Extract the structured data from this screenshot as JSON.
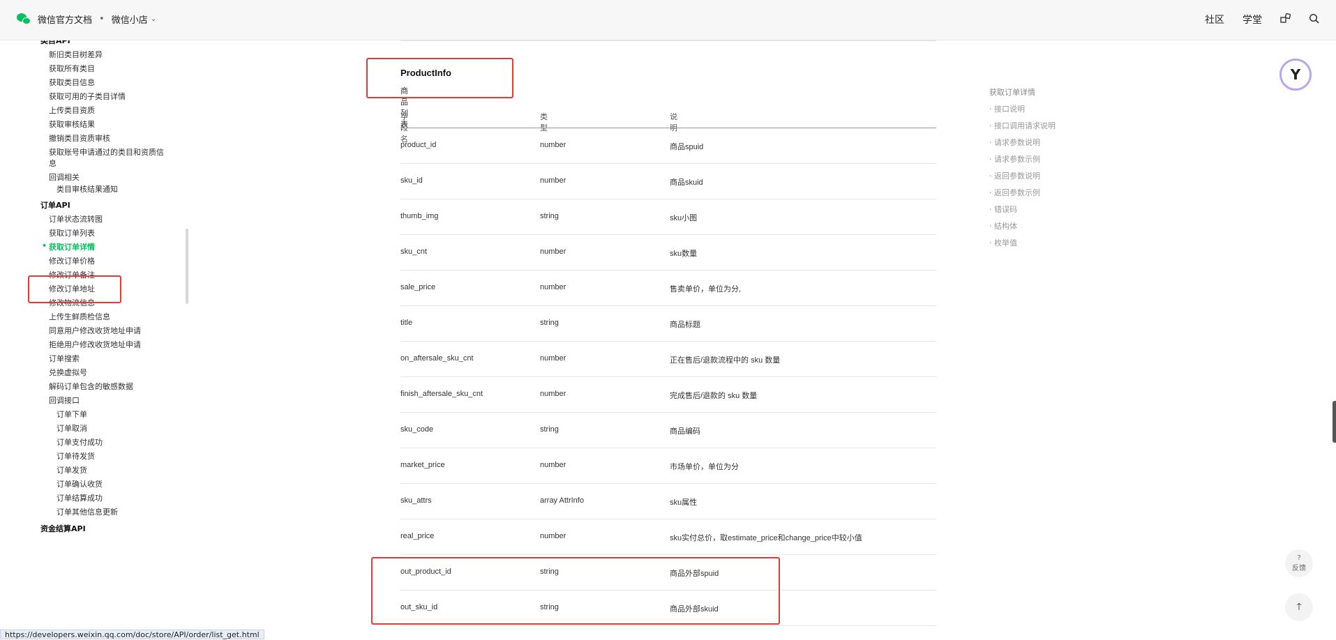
{
  "header": {
    "brand": "微信官方文档",
    "separator": "•",
    "section": "微信小店",
    "nav": [
      "社区",
      "学堂"
    ],
    "icons": [
      "grid-icon",
      "search-icon"
    ]
  },
  "sidebar": {
    "items": [
      {
        "text": "类目API",
        "type": "head",
        "indent": 0
      },
      {
        "text": "新旧类目树差异",
        "indent": 1
      },
      {
        "text": "获取所有类目",
        "indent": 1
      },
      {
        "text": "获取类目信息",
        "indent": 1
      },
      {
        "text": "获取可用的子类目详情",
        "indent": 1
      },
      {
        "text": "上传类目资质",
        "indent": 1
      },
      {
        "text": "获取审核结果",
        "indent": 1
      },
      {
        "text": "撤销类目资质审核",
        "indent": 1
      },
      {
        "text": "获取账号申请通过的类目和资质信",
        "indent": 1
      },
      {
        "text": "息",
        "indent": 1
      },
      {
        "text": "回调相关",
        "indent": 1
      },
      {
        "text": "类目审核结果通知",
        "indent": 2
      },
      {
        "text": "订单API",
        "type": "head",
        "indent": 0
      },
      {
        "text": "订单状态流转图",
        "indent": 1
      },
      {
        "text": "获取订单列表",
        "indent": 1
      },
      {
        "text": "获取订单详情",
        "indent": 1,
        "active": true
      },
      {
        "text": "修改订单价格",
        "indent": 1
      },
      {
        "text": "修改订单备注",
        "indent": 1
      },
      {
        "text": "修改订单地址",
        "indent": 1
      },
      {
        "text": "修改物流信息",
        "indent": 1
      },
      {
        "text": "上传生鲜质检信息",
        "indent": 1
      },
      {
        "text": "同意用户修改收货地址申请",
        "indent": 1
      },
      {
        "text": "拒绝用户修改收货地址申请",
        "indent": 1
      },
      {
        "text": "订单搜索",
        "indent": 1
      },
      {
        "text": "兑换虚拟号",
        "indent": 1
      },
      {
        "text": "解码订单包含的敏感数据",
        "indent": 1
      },
      {
        "text": "回调接口",
        "indent": 1
      },
      {
        "text": "订单下单",
        "indent": 2
      },
      {
        "text": "订单取消",
        "indent": 2
      },
      {
        "text": "订单支付成功",
        "indent": 2
      },
      {
        "text": "订单待发货",
        "indent": 2
      },
      {
        "text": "订单发货",
        "indent": 2
      },
      {
        "text": "订单确认收货",
        "indent": 2
      },
      {
        "text": "订单结算成功",
        "indent": 2
      },
      {
        "text": "订单其他信息更新",
        "indent": 2
      },
      {
        "text": "资金结算API",
        "type": "head",
        "indent": 0
      }
    ]
  },
  "content": {
    "title": "ProductInfo",
    "subtitle": "商品列表",
    "columns": [
      "字段名",
      "类型",
      "说明"
    ],
    "rows": [
      [
        "product_id",
        "number",
        "商品spuid"
      ],
      [
        "sku_id",
        "number",
        "商品skuid"
      ],
      [
        "thumb_img",
        "string",
        "sku小图"
      ],
      [
        "sku_cnt",
        "number",
        "sku数量"
      ],
      [
        "sale_price",
        "number",
        "售卖单价，单位为分,"
      ],
      [
        "title",
        "string",
        "商品标题"
      ],
      [
        "on_aftersale_sku_cnt",
        "number",
        "正在售后/退款流程中的 sku 数量"
      ],
      [
        "finish_aftersale_sku_cnt",
        "number",
        "完成售后/退款的 sku 数量"
      ],
      [
        "sku_code",
        "string",
        "商品编码"
      ],
      [
        "market_price",
        "number",
        "市场单价，单位为分"
      ],
      [
        "sku_attrs",
        "array AttrInfo",
        "sku属性"
      ],
      [
        "real_price",
        "number",
        "sku实付总价，取estimate_price和change_price中较小值"
      ],
      [
        "out_product_id",
        "string",
        "商品外部spuid"
      ],
      [
        "out_sku_id",
        "string",
        "商品外部skuid"
      ]
    ]
  },
  "toc": {
    "title": "获取订单详情",
    "items": [
      "接口说明",
      "接口调用请求说明",
      "请求参数说明",
      "请求参数示例",
      "返回参数说明",
      "返回参数示例",
      "错误码",
      "结构体",
      "枚举值"
    ]
  },
  "floating": {
    "badge_glyph": "Y",
    "feedback_q": "?",
    "feedback_label": "反馈",
    "to_top": "↑"
  },
  "status_url": "https://developers.weixin.qq.com/doc/store/API/order/list_get.html"
}
